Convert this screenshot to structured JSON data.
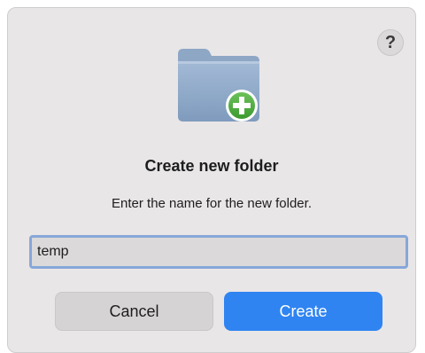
{
  "dialog": {
    "help_label": "?",
    "icon": "folder-add-icon",
    "title": "Create new folder",
    "message": "Enter the name for the new folder.",
    "input_value": "temp",
    "cancel_label": "Cancel",
    "create_label": "Create"
  },
  "colors": {
    "dialog_background": "#e9e6e7",
    "accent": "#2f84f1",
    "input_focus_ring": "#86a7d9",
    "folder": "#8fa9c8",
    "badge": "#4caa3f"
  }
}
